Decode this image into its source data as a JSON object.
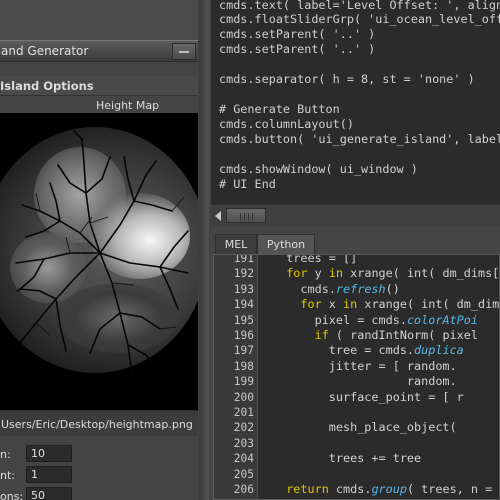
{
  "island_window": {
    "title": "and Generator",
    "frame_title": "Island Options",
    "heightmap_label": "Height Map",
    "image_path": "Users/Eric/Desktop/heightmap.png",
    "fields": [
      {
        "label": "n:",
        "value": "10"
      },
      {
        "label": "nt:",
        "value": "1"
      },
      {
        "label": "ons:",
        "value": "50"
      }
    ]
  },
  "script_editor": {
    "history_lines": [
      "cmds.text( label='Level Offset: ', align",
      "cmds.floatSliderGrp( 'ui_ocean_level_off",
      "cmds.setParent( '..' )",
      "cmds.setParent( '..' )",
      "",
      "cmds.separator( h = 8, st = 'none' )",
      "",
      "# Generate Button",
      "cmds.columnLayout()",
      "cmds.button( 'ui_generate_island', label=",
      "",
      "cmds.showWindow( ui_window )",
      "# UI End"
    ],
    "tabs": [
      {
        "label": "MEL",
        "active": false
      },
      {
        "label": "Python",
        "active": true
      }
    ],
    "code": [
      {
        "n": "191",
        "indent": 2,
        "parts": [
          {
            "t": "trees = []",
            "c": "plain"
          }
        ]
      },
      {
        "n": "192",
        "indent": 2,
        "parts": [
          {
            "t": "for",
            "c": "kw"
          },
          {
            "t": " y ",
            "c": "plain"
          },
          {
            "t": "in",
            "c": "kw"
          },
          {
            "t": " xrange( int( dm_dims[1",
            "c": "plain"
          }
        ]
      },
      {
        "n": "193",
        "indent": 4,
        "parts": [
          {
            "t": "cmds.",
            "c": "plain"
          },
          {
            "t": "refresh",
            "c": "fn"
          },
          {
            "t": "()",
            "c": "plain"
          }
        ]
      },
      {
        "n": "194",
        "indent": 4,
        "parts": [
          {
            "t": "for",
            "c": "kw"
          },
          {
            "t": " x ",
            "c": "plain"
          },
          {
            "t": "in",
            "c": "kw"
          },
          {
            "t": " xrange( int( dm_dim",
            "c": "plain"
          }
        ]
      },
      {
        "n": "195",
        "indent": 6,
        "parts": [
          {
            "t": "pixel = cmds.",
            "c": "plain"
          },
          {
            "t": "colorAtPoi",
            "c": "fn"
          }
        ]
      },
      {
        "n": "196",
        "indent": 6,
        "parts": [
          {
            "t": "if",
            "c": "kw"
          },
          {
            "t": " ( randIntNorm( pixel",
            "c": "plain"
          }
        ]
      },
      {
        "n": "197",
        "indent": 8,
        "parts": [
          {
            "t": "tree = cmds.",
            "c": "plain"
          },
          {
            "t": "duplica",
            "c": "fn"
          }
        ]
      },
      {
        "n": "198",
        "indent": 8,
        "parts": [
          {
            "t": "jitter = [ random.",
            "c": "plain"
          }
        ]
      },
      {
        "n": "199",
        "indent": 8,
        "parts": [
          {
            "t": "           random.",
            "c": "plain"
          }
        ]
      },
      {
        "n": "200",
        "indent": 8,
        "parts": [
          {
            "t": "surface_point = [ r",
            "c": "plain"
          }
        ]
      },
      {
        "n": "201",
        "indent": 0,
        "parts": []
      },
      {
        "n": "202",
        "indent": 8,
        "parts": [
          {
            "t": "mesh_place_object(",
            "c": "plain"
          }
        ]
      },
      {
        "n": "203",
        "indent": 0,
        "parts": []
      },
      {
        "n": "204",
        "indent": 8,
        "parts": [
          {
            "t": "trees += tree",
            "c": "plain"
          }
        ]
      },
      {
        "n": "205",
        "indent": 0,
        "parts": []
      },
      {
        "n": "206",
        "indent": 2,
        "parts": [
          {
            "t": "return",
            "c": "kw"
          },
          {
            "t": " cmds.",
            "c": "plain"
          },
          {
            "t": "group",
            "c": "fn"
          },
          {
            "t": "( trees, n =",
            "c": "plain"
          }
        ]
      }
    ]
  },
  "colors": {
    "keyword": "#e0c700",
    "function": "#55b8ea",
    "code_text": "#d2d2d2",
    "editor_bg": "#2b2b2b"
  }
}
